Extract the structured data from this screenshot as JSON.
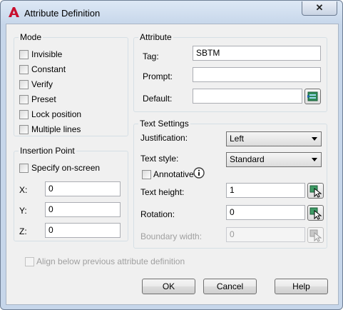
{
  "window": {
    "title": "Attribute Definition",
    "close_label": "✕"
  },
  "mode": {
    "title": "Mode",
    "items": [
      {
        "label": "Invisible",
        "checked": false
      },
      {
        "label": "Constant",
        "checked": false
      },
      {
        "label": "Verify",
        "checked": false
      },
      {
        "label": "Preset",
        "checked": false
      },
      {
        "label": "Lock position",
        "checked": false
      },
      {
        "label": "Multiple lines",
        "checked": false
      }
    ]
  },
  "insertion": {
    "title": "Insertion Point",
    "specify_label": "Specify on-screen",
    "x_label": "X:",
    "x_value": "0",
    "y_label": "Y:",
    "y_value": "0",
    "z_label": "Z:",
    "z_value": "0"
  },
  "attribute": {
    "title": "Attribute",
    "tag_label": "Tag:",
    "tag_value": "SBTM",
    "prompt_label": "Prompt:",
    "prompt_value": "",
    "default_label": "Default:",
    "default_value": ""
  },
  "text_settings": {
    "title": "Text Settings",
    "justification_label": "Justification:",
    "justification_value": "Left",
    "style_label": "Text style:",
    "style_value": "Standard",
    "annotative_label": "Annotative",
    "height_label": "Text height:",
    "height_value": "1",
    "rotation_label": "Rotation:",
    "rotation_value": "0",
    "boundary_label": "Boundary width:",
    "boundary_value": "0"
  },
  "align_label": "Align below previous attribute definition",
  "buttons": {
    "ok": "OK",
    "cancel": "Cancel",
    "help": "Help"
  },
  "colors": {
    "accent": "#c8102e",
    "frame": "#c6d6ea",
    "client": "#f0f0f0"
  }
}
